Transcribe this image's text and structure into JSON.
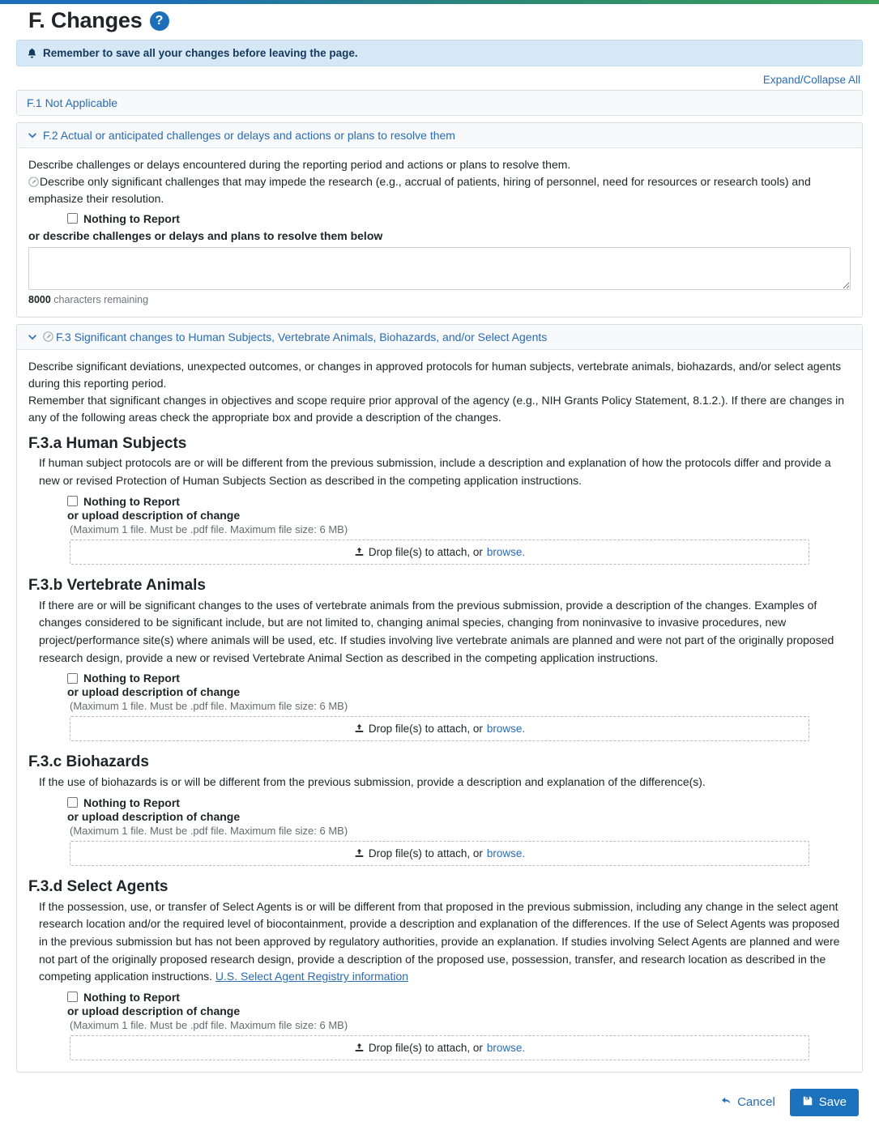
{
  "page": {
    "title": "F. Changes",
    "help_icon": "question-circle-icon",
    "alert": "Remember to save all your changes before leaving the page.",
    "expand_collapse": "Expand/Collapse All"
  },
  "sections": {
    "f1": {
      "title": "F.1 Not Applicable"
    },
    "f2": {
      "title": "F.2 Actual or anticipated challenges or delays and actions or plans to resolve them",
      "para1": "Describe challenges or delays encountered during the reporting period and actions or plans to resolve them.",
      "para2": "Describe only significant challenges that may impede the research (e.g., accrual of patients, hiring of personnel, need for resources or research tools) and emphasize their resolution.",
      "nothing_to_report": "Nothing to Report",
      "or_describe": "or describe challenges or delays and plans to resolve them below",
      "textarea_value": "",
      "textarea_placeholder": "",
      "char_count_number": "8000",
      "char_count_suffix": "characters remaining"
    },
    "f3": {
      "title": "F.3 Significant changes to Human Subjects, Vertebrate Animals, Biohazards, and/or Select Agents",
      "para1": "Describe significant deviations, unexpected outcomes, or changes in approved protocols for human subjects, vertebrate animals, biohazards, and/or select agents during this reporting period.",
      "para2": "Remember that significant changes in objectives and scope require prior approval of the agency (e.g., NIH Grants Policy Statement, 8.1.2.). If there are changes in any of the following areas check the appropriate box and provide a description of the changes.",
      "subsections": [
        {
          "heading": "F.3.a Human Subjects",
          "body": "If human subject protocols are or will be different from the previous submission, include a description and explanation of how the protocols differ and provide a new or revised Protection of Human Subjects Section as described in the competing application instructions.",
          "link_text": "",
          "nothing_to_report": "Nothing to Report",
          "or_upload": "or upload description of change",
          "file_hint": "(Maximum 1 file. Must be .pdf file. Maximum file size: 6 MB)",
          "drop_text": "Drop file(s) to attach, or",
          "browse_text": "browse."
        },
        {
          "heading": "F.3.b Vertebrate Animals",
          "body": "If there are or will be significant changes to the uses of vertebrate animals from the previous submission, provide a description of the changes. Examples of changes considered to be significant include, but are not limited to, changing animal species, changing from noninvasive to invasive procedures, new project/performance site(s) where animals will be used, etc. If studies involving live vertebrate animals are planned and were not part of the originally proposed research design, provide a new or revised Vertebrate Animal Section as described in the competing application instructions.",
          "link_text": "",
          "nothing_to_report": "Nothing to Report",
          "or_upload": "or upload description of change",
          "file_hint": "(Maximum 1 file. Must be .pdf file. Maximum file size: 6 MB)",
          "drop_text": "Drop file(s) to attach, or",
          "browse_text": "browse."
        },
        {
          "heading": "F.3.c Biohazards",
          "body": "If the use of biohazards is or will be different from the previous submission, provide a description and explanation of the difference(s).",
          "link_text": "",
          "nothing_to_report": "Nothing to Report",
          "or_upload": "or upload description of change",
          "file_hint": "(Maximum 1 file. Must be .pdf file. Maximum file size: 6 MB)",
          "drop_text": "Drop file(s) to attach, or",
          "browse_text": "browse."
        },
        {
          "heading": "F.3.d Select Agents",
          "body": "If the possession, use, or transfer of Select Agents is or will be different from that proposed in the previous submission, including any change in the select agent research location and/or the required level of biocontainment, provide a description and explanation of the differences. If the use of Select Agents was proposed in the previous submission but has not been approved by regulatory authorities, provide an explanation. If studies involving Select Agents are planned and were not part of the originally proposed research design, provide a description of the proposed use, possession, transfer, and research location as described in the competing application instructions.",
          "link_text": "U.S. Select Agent Registry information",
          "nothing_to_report": "Nothing to Report",
          "or_upload": "or upload description of change",
          "file_hint": "(Maximum 1 file. Must be .pdf file. Maximum file size: 6 MB)",
          "drop_text": "Drop file(s) to attach, or",
          "browse_text": "browse."
        }
      ]
    }
  },
  "footer": {
    "cancel": "Cancel",
    "save": "Save"
  },
  "colors": {
    "accent_blue": "#2a6bb5",
    "save_blue": "#1d72bd",
    "alert_bg": "#d6e7f5",
    "alert_text": "#14395c",
    "header_bg": "#f7f9fa"
  }
}
